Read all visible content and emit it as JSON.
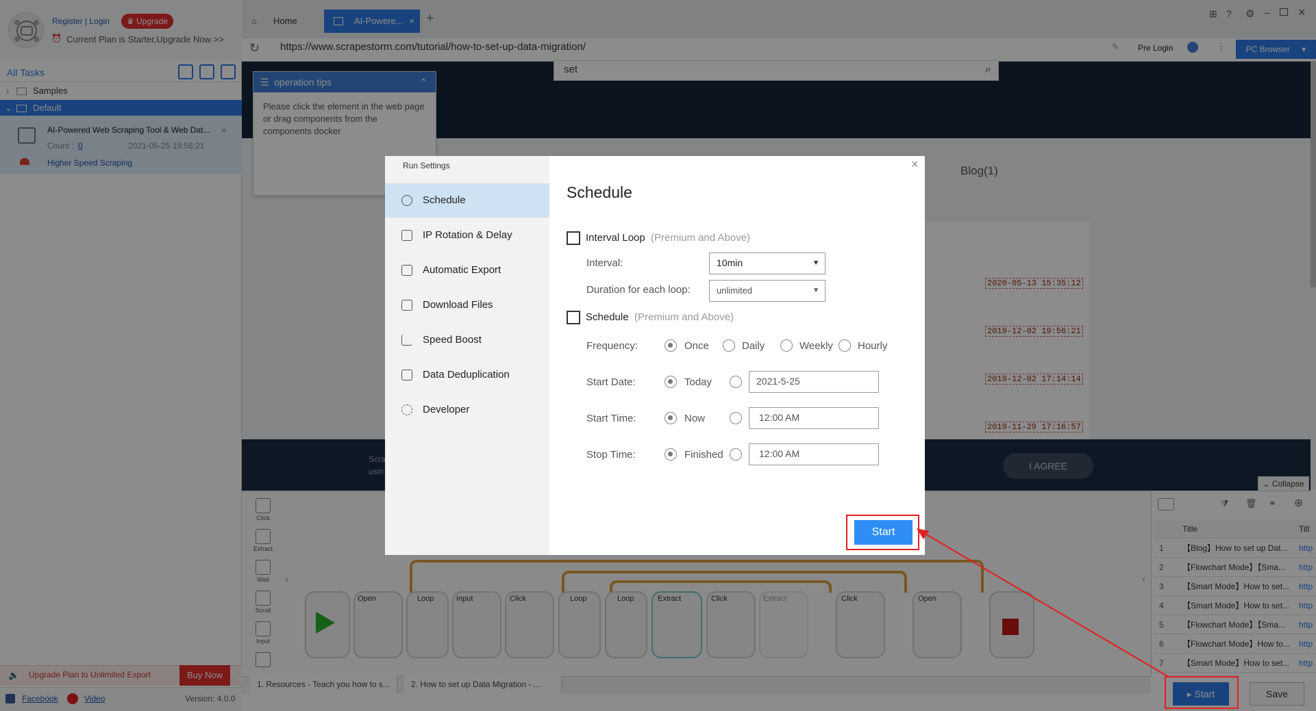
{
  "left_panel": {
    "register_login": "Register | Login",
    "upgrade": "Upgrade",
    "plan_text": "Current Plan is Starter,Upgrade Now >>",
    "all_tasks": "All Tasks",
    "tree": [
      {
        "label": "Samples"
      },
      {
        "label": "Default"
      }
    ],
    "task": {
      "title": "AI-Powered Web Scraping Tool & Web Dat...",
      "count_label": "Count :",
      "count_value": "0",
      "date": "2021-05-25 19:56:21",
      "speed_label": "Higher Speed Scraping"
    },
    "upgrade_bar": "Upgrade Plan to Unlimited Export",
    "buy_now": "Buy Now",
    "facebook": "Facebook",
    "video": "Video",
    "version": "Version: 4.0.0"
  },
  "browser": {
    "tabs": [
      {
        "label": "Home"
      },
      {
        "label": "AI-Powere..."
      }
    ],
    "url": "https://www.scrapestorm.com/tutorial/how-to-set-up-data-migration/",
    "pre_login": "Pre Login",
    "pc_browser": "PC Browser",
    "search_text": "set",
    "blog_label": "Blog(1)",
    "dates": [
      "2020-05-13 15:35:12",
      "2019-12-02 19:56:21",
      "2019-12-02 17:14:14",
      "2019-11-29 17:16:57"
    ],
    "cookie_text_1": "Scra",
    "cookie_text_2": "usin",
    "agree": "I AGREE"
  },
  "tips": {
    "title": "operation tips",
    "body": "Please click the element in the web page or drag components from the components docker"
  },
  "dock": [
    "Click",
    "Extract",
    "Wait",
    "Scroll",
    "Input"
  ],
  "workflow": {
    "nodes": [
      "Open",
      "Loop",
      "Input",
      "Click",
      "Loop",
      "Loop",
      "Extract",
      "Click",
      "Extract",
      "Click",
      "Open"
    ]
  },
  "bottom_tabs": [
    "1. Resources - Teach you how to s...",
    "2. How to set up Data Migration - ..."
  ],
  "collapse": "Collapse",
  "right_table": {
    "headers": [
      "Title",
      "Titl"
    ],
    "rows": [
      {
        "n": "1",
        "title": "【Blog】How to set up Dat...",
        "url": "http"
      },
      {
        "n": "2",
        "title": "【Flowchart Mode】【Sma...",
        "url": "http"
      },
      {
        "n": "3",
        "title": "【Smart Mode】How to set...",
        "url": "http"
      },
      {
        "n": "4",
        "title": "【Smart Mode】How to set...",
        "url": "http"
      },
      {
        "n": "5",
        "title": "【Flowchart Mode】【Sma...",
        "url": "http"
      },
      {
        "n": "6",
        "title": "【Flowchart Mode】How to...",
        "url": "http"
      },
      {
        "n": "7",
        "title": "【Smart Mode】How to set...",
        "url": "http"
      }
    ],
    "start": "Start",
    "save": "Save"
  },
  "dialog": {
    "title": "Run Settings",
    "menu": [
      {
        "label": "Schedule"
      },
      {
        "label": "IP Rotation & Delay"
      },
      {
        "label": "Automatic Export"
      },
      {
        "label": "Download Files"
      },
      {
        "label": "Speed Boost"
      },
      {
        "label": "Data Deduplication"
      },
      {
        "label": "Developer"
      }
    ],
    "heading": "Schedule",
    "interval_loop": "Interval Loop",
    "premium1": "(Premium and Above)",
    "interval_label": "Interval:",
    "interval_value": "10min",
    "duration_label": "Duration for each loop:",
    "duration_value": "unlimited",
    "schedule": "Schedule",
    "premium2": "(Premium and Above)",
    "frequency_label": "Frequency:",
    "frequency_options": [
      "Once",
      "Daily",
      "Weekly",
      "Hourly"
    ],
    "start_date_label": "Start Date:",
    "today": "Today",
    "start_date_value": "2021-5-25",
    "start_time_label": "Start Time:",
    "now": "Now",
    "start_time_value": "12:00 AM",
    "stop_time_label": "Stop Time:",
    "finished": "Finished",
    "stop_time_value": "12:00 AM",
    "start_button": "Start"
  },
  "colors": {
    "accent": "#2e7be5",
    "annotation_red": "#e21f1f",
    "upgrade_red": "#e2312e"
  }
}
